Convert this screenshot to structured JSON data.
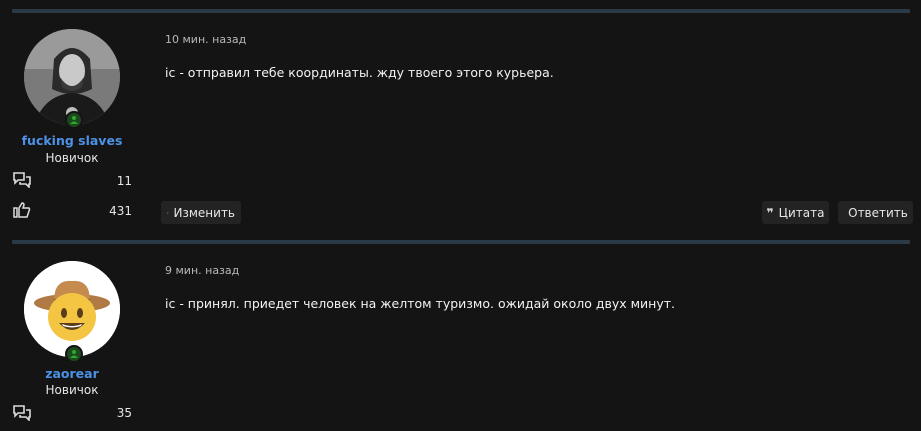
{
  "posts": [
    {
      "username": "fucking slaves",
      "rank": "Новичок",
      "messages_count": "11",
      "reactions_count": "431",
      "time": "10 мин. назад",
      "text": "ic - отправил тебе координаты. жду твоего этого курьера.",
      "avatar_icon": "photo-avatar"
    },
    {
      "username": "zaorear",
      "rank": "Новичок",
      "messages_count": "35",
      "time": "9 мин. назад",
      "text": "ic - принял. приедет человек на желтом туризмо. ожидай около двух минут.",
      "avatar_icon": "cowboy-emoji-avatar"
    }
  ],
  "actions": {
    "edit_label": "Изменить",
    "quote_label": "Цитата",
    "reply_label": "Ответить"
  },
  "colors": {
    "background": "#141414",
    "divider": "#2b3a47",
    "username": "#4c92e6",
    "online": "#2fa82f"
  }
}
